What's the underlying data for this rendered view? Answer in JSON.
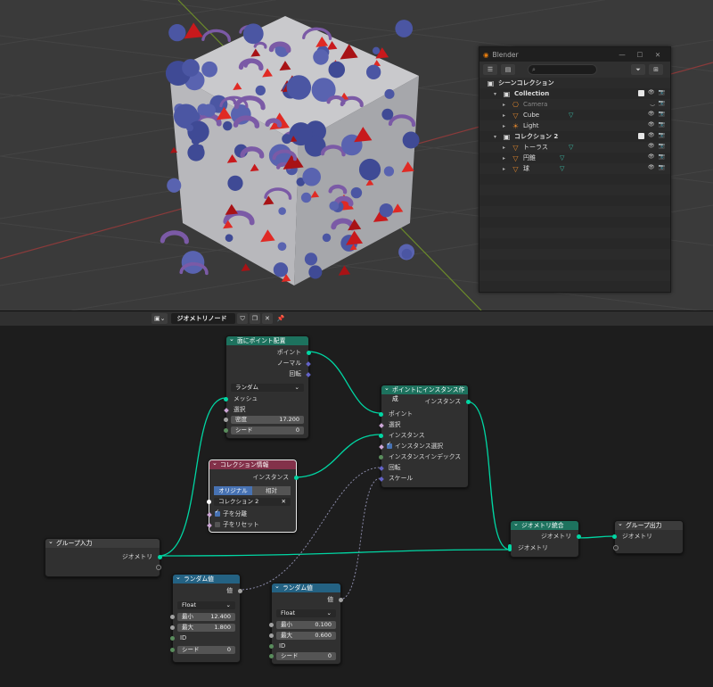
{
  "outliner": {
    "window_title": "Blender",
    "window_buttons": [
      "—",
      "☐",
      "✕"
    ],
    "search_placeholder": "",
    "rows": [
      {
        "name": "シーンコレクション",
        "type": "scene",
        "level": 0
      },
      {
        "name": "Collection",
        "type": "collection",
        "level": 1
      },
      {
        "name": "Camera",
        "type": "camera",
        "level": 2,
        "dim": true
      },
      {
        "name": "Cube",
        "type": "mesh",
        "level": 2
      },
      {
        "name": "Light",
        "type": "light",
        "level": 2
      },
      {
        "name": "コレクション 2",
        "type": "collection",
        "level": 1
      },
      {
        "name": "トーラス",
        "type": "mesh",
        "level": 2
      },
      {
        "name": "円錐",
        "type": "mesh",
        "level": 2
      },
      {
        "name": "球",
        "type": "mesh",
        "level": 2
      }
    ]
  },
  "node_editor": {
    "tree_name": "ジオメトリノード",
    "nodes": {
      "distribute": {
        "title": "面にポイント配置",
        "out_points": "ポイント",
        "out_normal": "ノーマル",
        "out_rotation": "回転",
        "mode": "ランダム",
        "in_mesh": "メッシュ",
        "in_selection": "選択",
        "density_label": "密度",
        "density_value": "17.200",
        "seed_label": "シード",
        "seed_value": "0"
      },
      "instance": {
        "title": "ポイントにインスタンス作成",
        "out_instances": "インスタンス",
        "in_points": "ポイント",
        "in_selection": "選択",
        "in_instance": "インスタンス",
        "pick_instance": "インスタンス選択",
        "instance_index": "インスタンスインデックス",
        "rotation": "回転",
        "scale": "スケール"
      },
      "collection_info": {
        "title": "コレクション情報",
        "out_instances": "インスタンス",
        "seg_original": "オリジナル",
        "seg_relative": "相対",
        "collection": "コレクション 2",
        "separate_children": "子を分離",
        "reset_children": "子をリセット"
      },
      "group_input": {
        "title": "グループ入力",
        "out_geometry": "ジオメトリ"
      },
      "join": {
        "title": "ジオメトリ統合",
        "out_geometry": "ジオメトリ",
        "in_geometry": "ジオメトリ"
      },
      "group_output": {
        "title": "グループ出力",
        "in_geometry": "ジオメトリ"
      },
      "random1": {
        "title": "ランダム値",
        "out_value": "値",
        "type": "Float",
        "min_label": "最小",
        "min_value": "12.400",
        "max_label": "最大",
        "max_value": "1.800",
        "id_label": "ID",
        "seed_label": "シード",
        "seed_value": "0"
      },
      "random2": {
        "title": "ランダム値",
        "out_value": "値",
        "type": "Float",
        "min_label": "最小",
        "min_value": "0.100",
        "max_label": "最大",
        "max_value": "0.600",
        "id_label": "ID",
        "seed_label": "シード",
        "seed_value": "0"
      }
    }
  },
  "colors": {
    "geometry_socket": "#00d6a3",
    "vector_socket": "#6363c7",
    "float_socket": "#a1a1a1",
    "geometry_header": "#1d725e",
    "input_header": "#83314a",
    "utility_header": "#246283"
  }
}
